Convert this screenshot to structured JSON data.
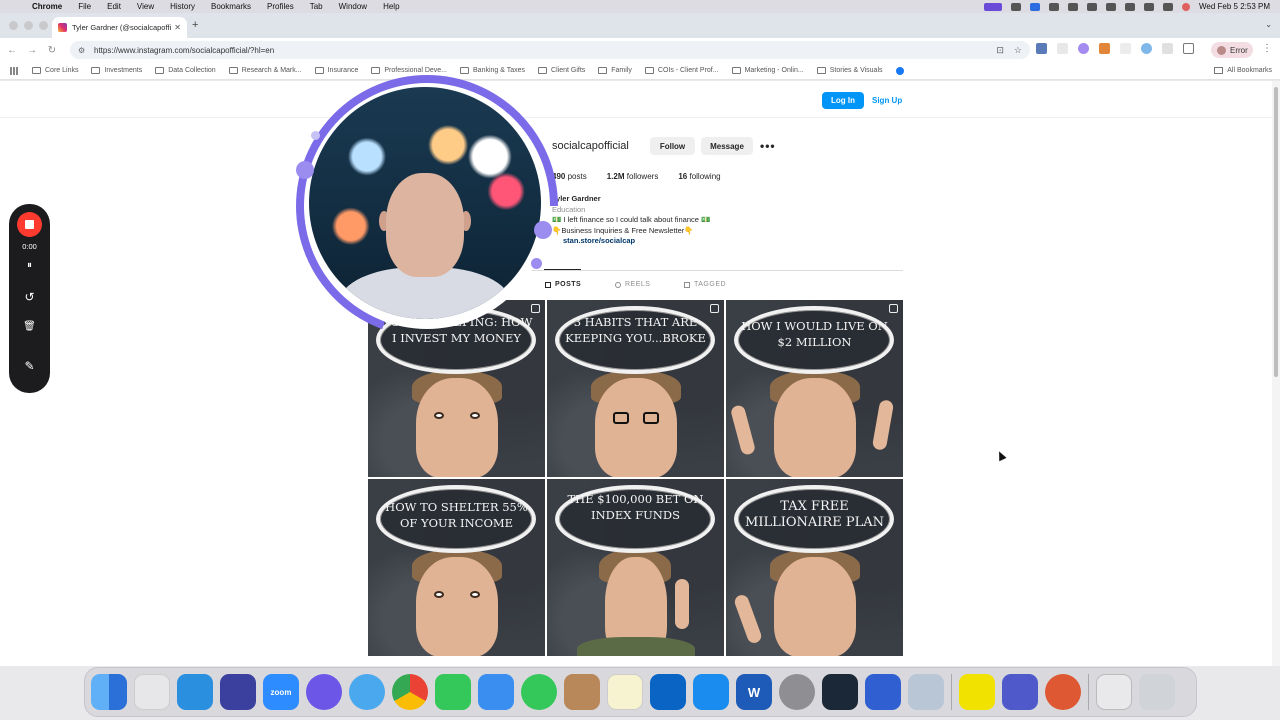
{
  "menubar": {
    "apple": "",
    "items": [
      "Chrome",
      "File",
      "Edit",
      "View",
      "History",
      "Bookmarks",
      "Profiles",
      "Tab",
      "Window",
      "Help"
    ],
    "clock": "Wed Feb 5  2:53 PM"
  },
  "browser": {
    "tab_title": "Tyler Gardner (@socialcapoffi",
    "tab_close": "✕",
    "new_tab": "+",
    "url": "https://www.instagram.com/socialcapofficial/?hl=en",
    "profile_status": "Error",
    "bookmarks": [
      "Core Links",
      "Investments",
      "Data Collection",
      "Research & Mark...",
      "Insurance",
      "Professional Deve...",
      "Banking & Taxes",
      "Client Gifts",
      "Family",
      "COIs - Client Prof...",
      "Marketing - Onlin...",
      "Stories & Visuals"
    ],
    "all_bookmarks": "All Bookmarks"
  },
  "instagram": {
    "login": "Log In",
    "signup": "Sign Up",
    "username": "socialcapofficial",
    "follow": "Follow",
    "message": "Message",
    "more": "•••",
    "stats": {
      "posts_count": "490",
      "posts_label": "posts",
      "followers_count": "1.2M",
      "followers_label": "followers",
      "following_count": "16",
      "following_label": "following"
    },
    "bio": {
      "name": "Tyler Gardner",
      "category": "Education",
      "line1": "💵 I left finance so I could talk about finance 💵",
      "line2": "👇Business Inquiries & Free Newsletter👇",
      "link": "stan.store/socialcap"
    },
    "tabs": [
      "POSTS",
      "REELS",
      "TAGGED"
    ],
    "posts": [
      "NO GATEKEEPING: HOW I INVEST MY MONEY",
      "3 HABITS THAT ARE KEEPING YOU...BROKE",
      "HOW I WOULD LIVE ON $2 MILLION",
      "HOW TO SHELTER 55% OF YOUR INCOME",
      "THE $100,000 BET ON INDEX FUNDS",
      "TAX FREE MILLIONAIRE PLAN"
    ]
  },
  "recorder": {
    "time": "0:00",
    "pause_icon": "⏸",
    "restart_icon": "↺",
    "delete_icon": "🗑",
    "draw_icon": "✎"
  },
  "dock": {
    "zoom_label": "zoom",
    "word_label": "W"
  }
}
